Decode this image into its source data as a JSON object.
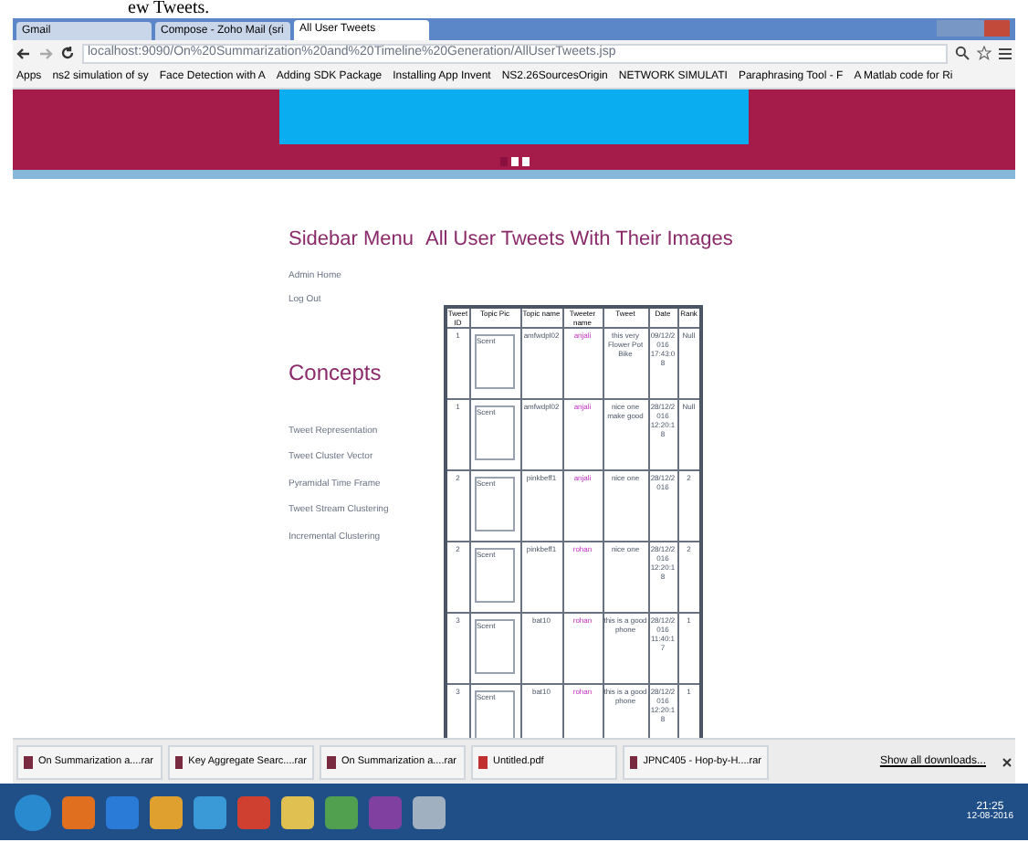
{
  "caption": "ew Tweets.",
  "tabs": [
    {
      "label": "Gmail",
      "selected": false
    },
    {
      "label": "Compose - Zoho Mail (sri",
      "selected": false
    },
    {
      "label": "All User Tweets",
      "selected": true
    }
  ],
  "address": "localhost:9090/On%20Summarization%20and%20Timeline%20Generation/AllUserTweets.jsp",
  "bookmarks": [
    "Apps",
    "ns2 simulation of sy",
    "Face Detection with A",
    "Adding SDK Package",
    "Installing App Invent",
    "NS2.26SourcesOrigin",
    "NETWORK SIMULATI",
    "Paraphrasing Tool - F",
    "A Matlab code for Ri"
  ],
  "slides": [
    {
      "selected": true
    },
    {
      "selected": false
    },
    {
      "selected": false
    }
  ],
  "sidebar": {
    "title": "Sidebar Menu",
    "items": [
      "Admin Home",
      "Log Out"
    ],
    "concepts_title": "Concepts",
    "concepts": [
      "Tweet Representation",
      "Tweet Cluster Vector",
      "Pyramidal Time Frame",
      "Tweet Stream Clustering",
      "Incremental Clustering"
    ]
  },
  "main": {
    "title": "All User Tweets With Their Images",
    "table": {
      "columns": [
        "Tweet ID",
        "Topic Pic",
        "Topic name",
        "Tweeter name",
        "Tweet",
        "Date",
        "Rank"
      ],
      "rows": [
        {
          "id": "1",
          "pic": "Scent",
          "topic": "amfwdpl02",
          "user": "anjali",
          "tweet": "this very Flower Pot Bike",
          "date": "09/12/2016 17:43:08",
          "rank": "Null"
        },
        {
          "id": "1",
          "pic": "Scent",
          "topic": "amfwdpl02",
          "user": "anjali",
          "tweet": "nice one make good",
          "date": "28/12/2016 12:20:18",
          "rank": "Null"
        },
        {
          "id": "2",
          "pic": "Scent",
          "topic": "pinkbeff1",
          "user": "anjali",
          "tweet": "nice one",
          "date": "28/12/2016",
          "rank": "2"
        },
        {
          "id": "2",
          "pic": "Scent",
          "topic": "pinkbeff1",
          "user": "rohan",
          "tweet": "nice one",
          "date": "28/12/2016 12:20:18",
          "rank": "2"
        },
        {
          "id": "3",
          "pic": "Scent",
          "topic": "bat10",
          "user": "rohan",
          "tweet": "this is a good phone",
          "date": "28/12/2016 11:40:17",
          "rank": "1"
        },
        {
          "id": "3",
          "pic": "Scent",
          "topic": "bat10",
          "user": "rohan",
          "tweet": "this is a good phone",
          "date": "28/12/2016 12:20:18",
          "rank": "1"
        }
      ]
    }
  },
  "downloads": [
    "On Summarization a....rar",
    "Key Aggregate Searc....rar",
    "On Summarization a....rar",
    "Untitled.pdf",
    "JPNC405 - Hop-by-H....rar"
  ],
  "show_all": "Show all downloads...",
  "clock": {
    "time": "21:25",
    "date": "12-08-2016"
  }
}
